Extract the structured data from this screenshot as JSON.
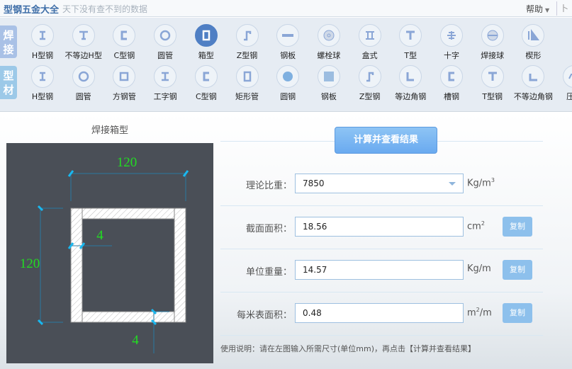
{
  "header": {
    "title": "型钢五金大全",
    "slogan": "天下没有查不到的数据",
    "help": "帮助",
    "more": "卜"
  },
  "toolbar": {
    "tabs": [
      {
        "label": "焊接",
        "color": "#a9c1e6"
      },
      {
        "label": "型材",
        "color": "#9cc9e8"
      }
    ],
    "welded": [
      {
        "label": "H型钢",
        "icon": "h-beam-icon"
      },
      {
        "label": "不等边H型",
        "icon": "unequal-h-icon"
      },
      {
        "label": "C型钢",
        "icon": "c-channel-icon"
      },
      {
        "label": "圆管",
        "icon": "round-pipe-icon"
      },
      {
        "label": "箱型",
        "icon": "box-section-icon",
        "active": true
      },
      {
        "label": "Z型钢",
        "icon": "z-section-icon"
      },
      {
        "label": "钢板",
        "icon": "plate-icon"
      },
      {
        "label": "螺栓球",
        "icon": "bolt-ball-icon"
      },
      {
        "label": "盒式",
        "icon": "box-type-icon"
      },
      {
        "label": "T型",
        "icon": "t-section-icon"
      },
      {
        "label": "十字",
        "icon": "cross-icon"
      },
      {
        "label": "焊接球",
        "icon": "welded-ball-icon"
      },
      {
        "label": "楔形",
        "icon": "wedge-icon"
      }
    ],
    "profiles": [
      {
        "label": "H型钢",
        "icon": "h-beam-icon"
      },
      {
        "label": "圆管",
        "icon": "round-pipe-icon"
      },
      {
        "label": "方钢管",
        "icon": "square-tube-icon"
      },
      {
        "label": "工字钢",
        "icon": "i-beam-icon"
      },
      {
        "label": "C型钢",
        "icon": "c-channel-icon"
      },
      {
        "label": "矩形管",
        "icon": "rect-tube-icon"
      },
      {
        "label": "圆钢",
        "icon": "round-bar-icon"
      },
      {
        "label": "钢板",
        "icon": "plate-icon"
      },
      {
        "label": "Z型钢",
        "icon": "z-section-icon"
      },
      {
        "label": "等边角钢",
        "icon": "equal-angle-icon"
      },
      {
        "label": "槽钢",
        "icon": "channel-icon"
      },
      {
        "label": "T型钢",
        "icon": "t-section-icon"
      },
      {
        "label": "不等边角钢",
        "icon": "unequal-angle-icon"
      },
      {
        "label": "压型",
        "icon": "profiled-sheet-icon"
      }
    ]
  },
  "drawing": {
    "title": "焊接箱型",
    "width": "120",
    "height": "120",
    "web_thickness": "4",
    "flange_thickness": "4",
    "dim_color": "#22dd22"
  },
  "form": {
    "calc_button": "计算并查看结果",
    "density": {
      "label": "理论比重：",
      "value": "7850",
      "unit": "Kg/m",
      "unit_sup": "3"
    },
    "area": {
      "label": "截面面积：",
      "value": "18.56",
      "unit": "cm",
      "unit_sup": "2",
      "copy": "复制"
    },
    "weight": {
      "label": "单位重量：",
      "value": "14.57",
      "unit": "Kg/m",
      "copy": "复制"
    },
    "surface": {
      "label": "每米表面积：",
      "value": "0.48",
      "unit_pre": "m",
      "unit_sup": "2",
      "unit_post": "/m",
      "copy": "复制"
    },
    "hint": "使用说明：请在左图输入所需尺寸(单位mm)，再点击【计算并查看结果】"
  }
}
